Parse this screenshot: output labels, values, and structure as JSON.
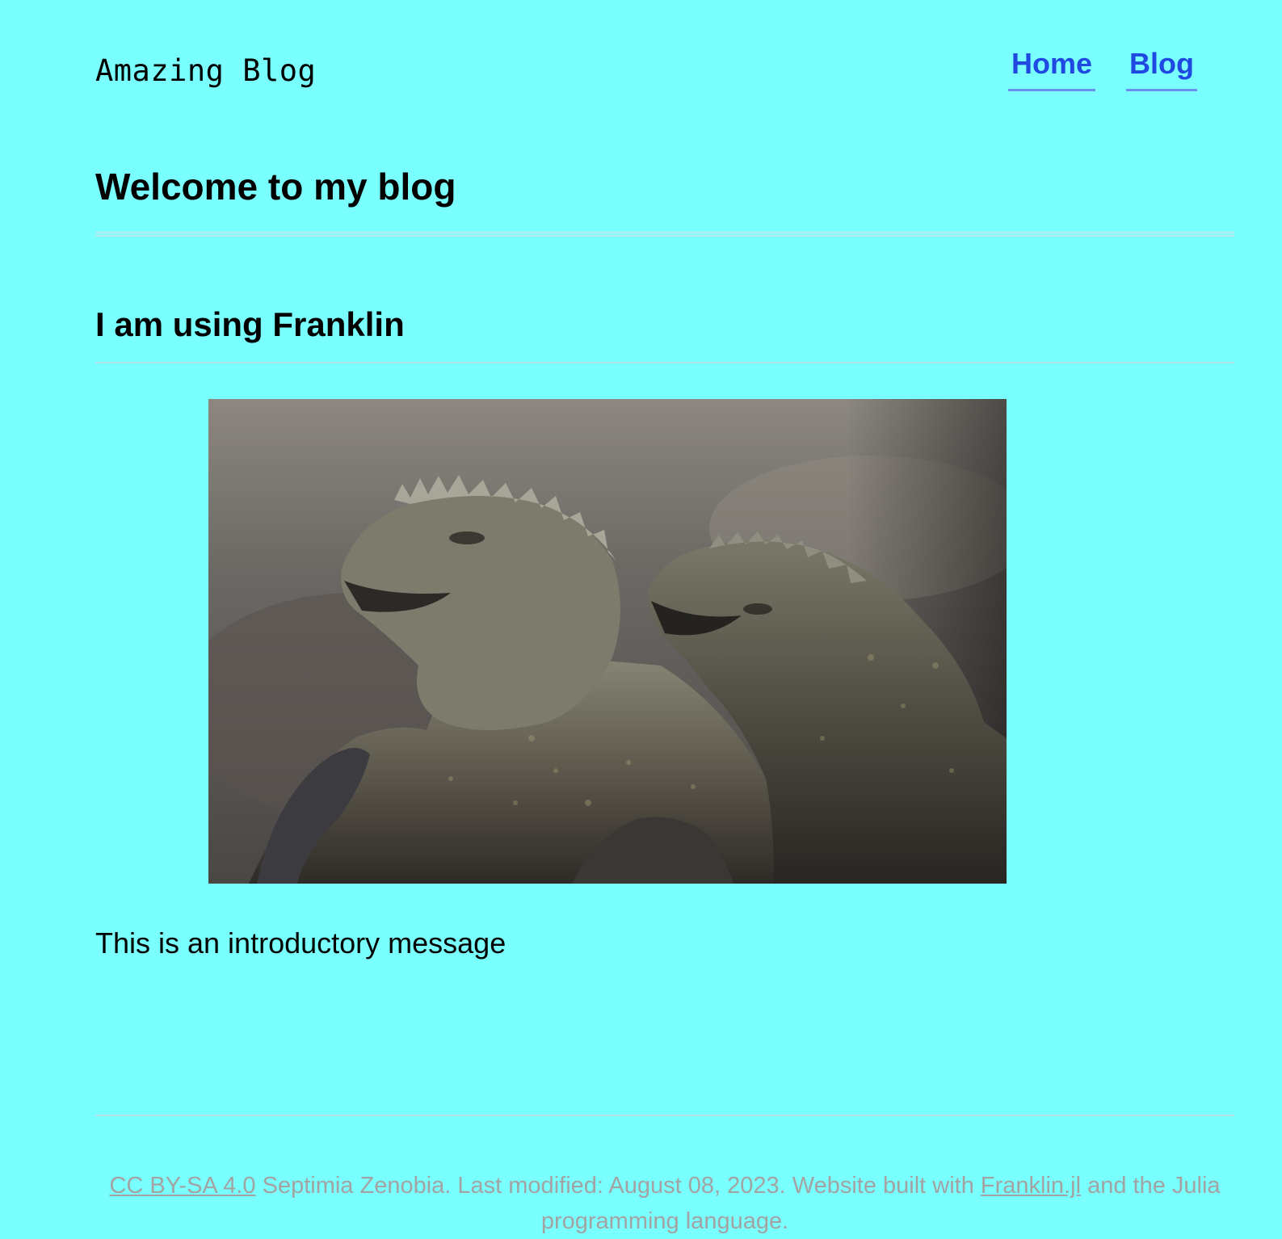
{
  "header": {
    "site_title": "Amazing Blog",
    "nav": [
      {
        "label": "Home"
      },
      {
        "label": "Blog"
      }
    ]
  },
  "main": {
    "title": "Welcome to my blog",
    "subtitle": "I am using Franklin",
    "image": {
      "subject": "two marine iguanas"
    },
    "intro_text": "This is an introductory message"
  },
  "footer": {
    "license_link": "CC BY-SA 4.0",
    "text_1": " Septimia Zenobia. Last modified: August 08, 2023. Website built with ",
    "franklin_link": "Franklin.jl",
    "text_2": " and the Julia programming language."
  },
  "colors": {
    "background": "#7affff",
    "link": "#1f49e0",
    "nav_underline": "#6c8ef0",
    "footer_text": "#a3a3a3"
  }
}
